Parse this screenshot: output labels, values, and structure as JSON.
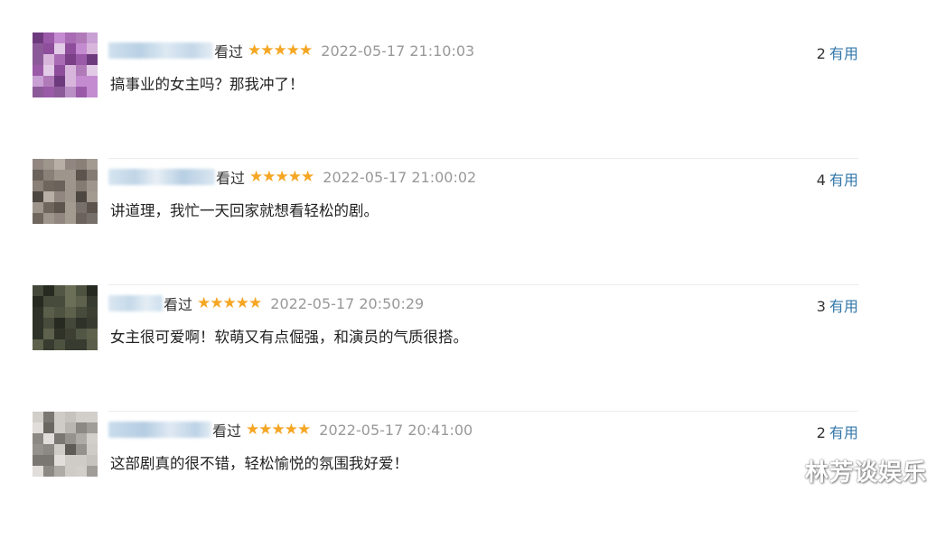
{
  "comments": [
    {
      "watched_label": "看过",
      "rating_stars": 5,
      "time": "2022-05-17 21:10:03",
      "useful_count": "2",
      "useful_label": "有用",
      "text": "搞事业的女主吗？那我冲了！"
    },
    {
      "watched_label": "看过",
      "rating_stars": 5,
      "time": "2022-05-17 21:00:02",
      "useful_count": "4",
      "useful_label": "有用",
      "text": "讲道理，我忙一天回家就想看轻松的剧。"
    },
    {
      "watched_label": "看过",
      "rating_stars": 5,
      "time": "2022-05-17 20:50:29",
      "useful_count": "3",
      "useful_label": "有用",
      "text": "女主很可爱啊！软萌又有点倔强，和演员的气质很搭。"
    },
    {
      "watched_label": "看过",
      "rating_stars": 5,
      "time": "2022-05-17 20:41:00",
      "useful_count": "2",
      "useful_label": "有用",
      "text": "这部剧真的很不错，轻松愉悦的氛围我好爱！"
    }
  ],
  "watermark": "林芳谈娱乐",
  "colors": {
    "star": "#f5a623",
    "link": "#3377aa",
    "time": "#999999",
    "divider": "#ececec"
  }
}
